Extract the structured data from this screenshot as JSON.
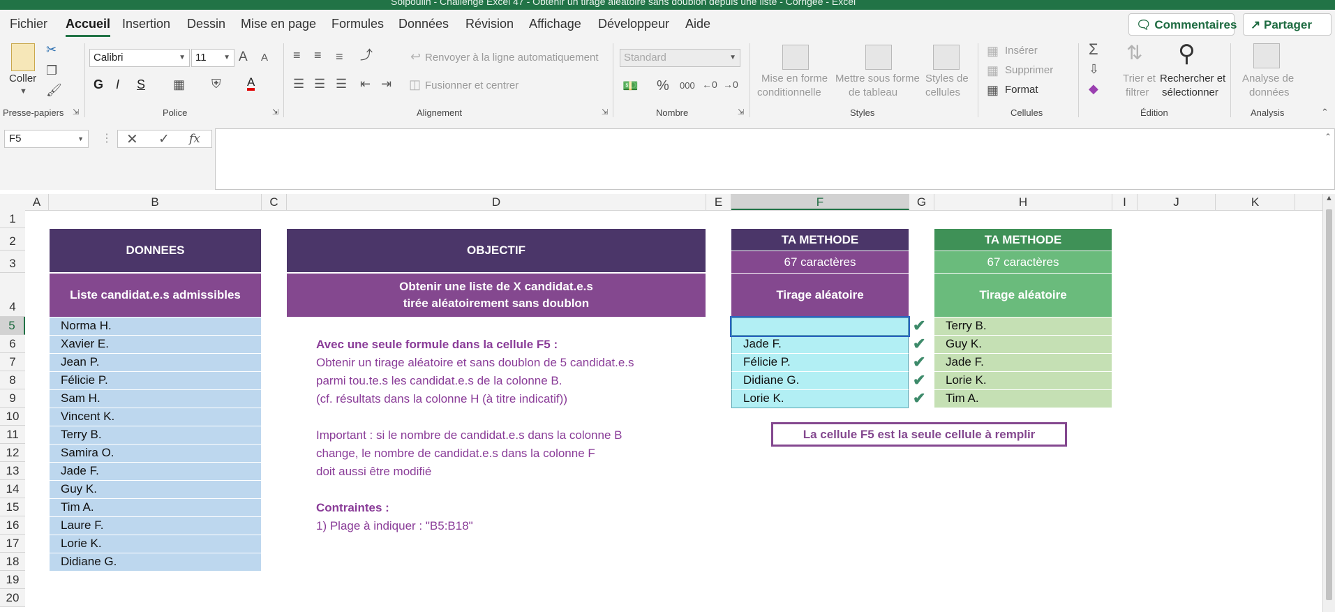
{
  "titlebar": {
    "text": "Soipoulin - Challenge Excel 47 - Obtenir un tirage aléatoire sans doublon depuis une liste - Corrigée - Excel"
  },
  "menu": {
    "tabs": [
      "Fichier",
      "Accueil",
      "Insertion",
      "Dessin",
      "Mise en page",
      "Formules",
      "Données",
      "Révision",
      "Affichage",
      "Développeur",
      "Aide"
    ],
    "active": "Accueil"
  },
  "topbuttons": {
    "comments": "Commentaires",
    "share": "Partager"
  },
  "ribbon": {
    "clipboard": {
      "paste": "Coller",
      "label": "Presse-papiers"
    },
    "font": {
      "name": "Calibri",
      "size": "11",
      "label": "Police",
      "bold": "G",
      "italic": "I",
      "underline": "S",
      "grow": "A",
      "shrink": "A"
    },
    "alignment": {
      "wrap": "Renvoyer à la ligne automatiquement",
      "merge": "Fusionner et centrer",
      "label": "Alignement"
    },
    "number": {
      "format": "Standard",
      "percent": "%",
      "thousands": "000",
      "label": "Nombre"
    },
    "styles": {
      "conditional_1": "Mise en forme",
      "conditional_2": "conditionnelle",
      "table_1": "Mettre sous forme",
      "table_2": "de tableau",
      "cell_1": "Styles de",
      "cell_2": "cellules",
      "label": "Styles"
    },
    "cells": {
      "insert": "Insérer",
      "delete": "Supprimer",
      "format": "Format",
      "label": "Cellules"
    },
    "editing": {
      "sort_1": "Trier et",
      "sort_2": "filtrer",
      "find_1": "Rechercher et",
      "find_2": "sélectionner",
      "label": "Édition"
    },
    "analysis": {
      "data_1": "Analyse de",
      "data_2": "données",
      "label": "Analysis"
    }
  },
  "formulabar": {
    "namebox": "F5",
    "formula": ""
  },
  "columns": [
    "A",
    "B",
    "C",
    "D",
    "E",
    "F",
    "G",
    "H",
    "I",
    "J",
    "K"
  ],
  "rows": [
    "1",
    "2",
    "3",
    "4",
    "5",
    "6",
    "7",
    "8",
    "9",
    "10",
    "11",
    "12",
    "13",
    "14",
    "15",
    "16",
    "17",
    "18",
    "19",
    "20"
  ],
  "sheet": {
    "donnees_header": "DONNEES",
    "list_header": "Liste candidat.e.s admissibles",
    "candidates": [
      "Norma H.",
      "Xavier E.",
      "Jean P.",
      "Félicie P.",
      "Sam H.",
      "Vincent K.",
      "Terry B.",
      "Samira O.",
      "Jade F.",
      "Guy K.",
      "Tim A.",
      "Laure F.",
      "Lorie K.",
      "Didiane G."
    ],
    "objectif_header": "OBJECTIF",
    "objectif_line1": "Obtenir une liste de X candidat.e.s",
    "objectif_line2": "tirée aléatoirement sans doublon",
    "desc": {
      "line1": "Avec une seule formule dans la cellule F5 :",
      "line2": "Obtenir un tirage aléatoire et sans doublon de 5 candidat.e.s",
      "line3": "parmi tou.te.s les candidat.e.s de la colonne B.",
      "line4": "(cf. résultats dans la colonne H (à titre indicatif))",
      "line5": "Important : si le nombre de candidat.e.s dans la colonne B",
      "line6": "change, le nombre de candidat.e.s dans la colonne F",
      "line7": "doit aussi être modifié",
      "line8": "Contraintes :",
      "line9": "1) Plage à indiquer : \"B5:B18\""
    },
    "f_col": {
      "title": "TA METHODE",
      "chars": "67 caractères",
      "sub": "Tirage aléatoire",
      "results": [
        "",
        "Jade F.",
        "Félicie P.",
        "Didiane G.",
        "Lorie K."
      ]
    },
    "h_col": {
      "title": "TA METHODE",
      "chars": "67 caractères",
      "sub": "Tirage aléatoire",
      "results": [
        "Terry B.",
        "Guy K.",
        "Jade F.",
        "Lorie K.",
        "Tim A."
      ]
    },
    "note": "La cellule F5 est la seule cellule à remplir"
  },
  "colors": {
    "excel_green": "#217346",
    "purple_dark": "#4b3669",
    "purple_mid": "#84488f",
    "blue_list": "#bdd7ee",
    "cyan_result": "#b2eff4",
    "green_dark": "#3f9157",
    "green_light": "#c5e0b4"
  }
}
